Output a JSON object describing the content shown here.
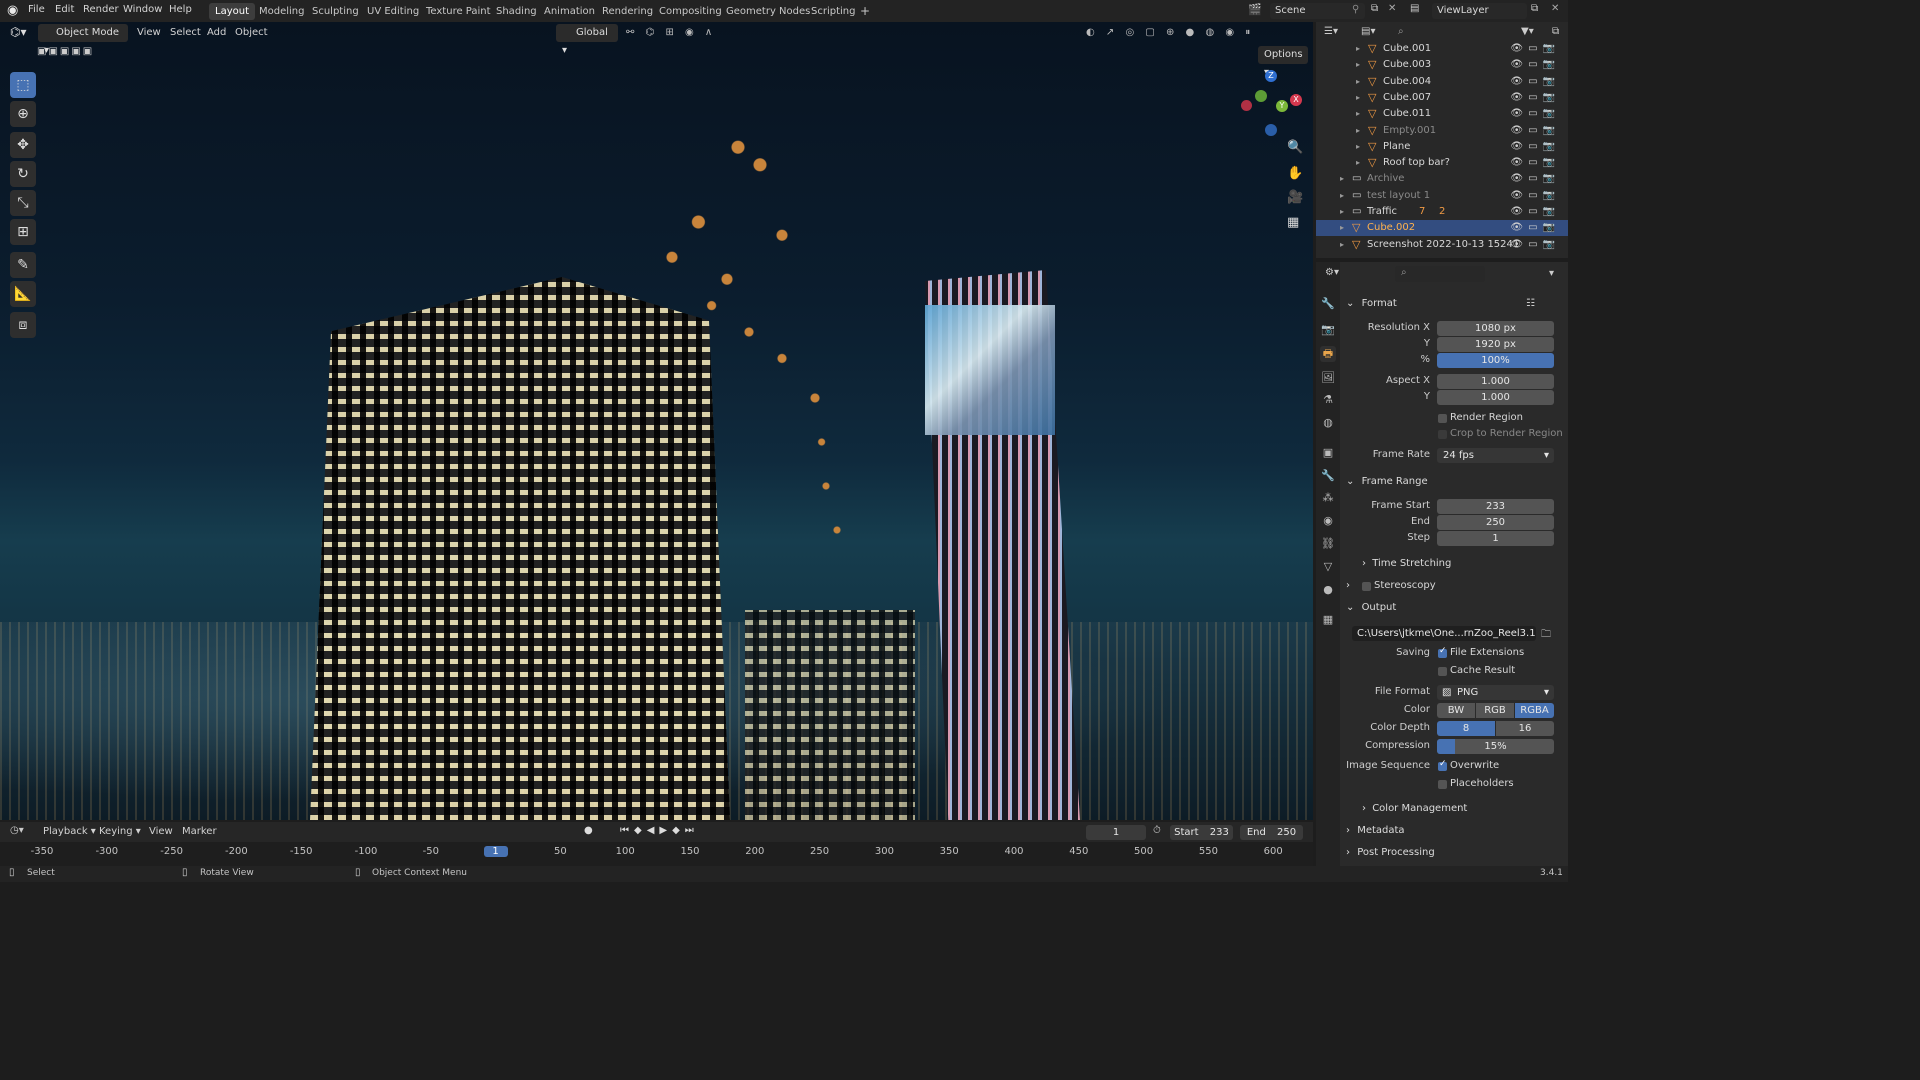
{
  "topbar": {
    "menus": [
      "File",
      "Edit",
      "Render",
      "Window",
      "Help"
    ],
    "workspaces": [
      "Layout",
      "Modeling",
      "Sculpting",
      "UV Editing",
      "Texture Paint",
      "Shading",
      "Animation",
      "Rendering",
      "Compositing",
      "Geometry Nodes",
      "Scripting"
    ],
    "add_tab": "+",
    "scene": "Scene",
    "view_layer": "ViewLayer"
  },
  "viewport_header": {
    "mode": "Object Mode",
    "menus": [
      "View",
      "Select",
      "Add",
      "Object"
    ],
    "transform_orientation": "Global",
    "options": "Options"
  },
  "outliner": {
    "rows": [
      {
        "label": "Cube.001",
        "kind": "object"
      },
      {
        "label": "Cube.003",
        "kind": "object"
      },
      {
        "label": "Cube.004",
        "kind": "object"
      },
      {
        "label": "Cube.007",
        "kind": "object"
      },
      {
        "label": "Cube.011",
        "kind": "object"
      },
      {
        "label": "Empty.001",
        "kind": "empty-dim"
      },
      {
        "label": "Plane",
        "kind": "object"
      },
      {
        "label": "Roof top bar?",
        "kind": "object"
      },
      {
        "label": "Archive",
        "kind": "collection-dim"
      },
      {
        "label": "test layout 1",
        "kind": "collection-dim"
      },
      {
        "label": "Traffic",
        "kind": "collection"
      },
      {
        "label": "Cube.002",
        "kind": "selected"
      },
      {
        "label": "Screenshot 2022-10-13 15241",
        "kind": "object"
      }
    ],
    "traffic_count_1": "7",
    "traffic_count_2": "2"
  },
  "properties": {
    "format": {
      "title": "Format",
      "resolution_x_label": "Resolution X",
      "resolution_x": "1080 px",
      "y_label": "Y",
      "resolution_y": "1920 px",
      "percent_label": "%",
      "percent": "100%",
      "aspect_x_label": "Aspect X",
      "aspect_x": "1.000",
      "aspect_y_label": "Y",
      "aspect_y": "1.000",
      "render_region": "Render Region",
      "crop": "Crop to Render Region",
      "frame_rate_label": "Frame Rate",
      "frame_rate": "24 fps"
    },
    "frame_range": {
      "title": "Frame Range",
      "start_label": "Frame Start",
      "start": "233",
      "end_label": "End",
      "end": "250",
      "step_label": "Step",
      "step": "1",
      "time_stretching": "Time Stretching"
    },
    "stereoscopy": "Stereoscopy",
    "output": {
      "title": "Output",
      "path": "C:\\Users\\jtkme\\One...rnZoo_Reel3.1.blend",
      "saving_label": "Saving",
      "file_extensions": "File Extensions",
      "cache_result": "Cache Result",
      "file_format_label": "File Format",
      "file_format": "PNG",
      "color_label": "Color",
      "color_options": [
        "BW",
        "RGB",
        "RGBA"
      ],
      "color_selected": "RGBA",
      "depth_label": "Color Depth",
      "depth_options": [
        "8",
        "16"
      ],
      "depth_selected": "8",
      "compression_label": "Compression",
      "compression": "15%",
      "compression_value": 0.15,
      "image_sequence_label": "Image Sequence",
      "overwrite": "Overwrite",
      "placeholders": "Placeholders",
      "color_management": "Color Management"
    },
    "metadata": "Metadata",
    "post_processing": "Post Processing"
  },
  "timeline": {
    "menus": [
      "Playback",
      "Keying",
      "View",
      "Marker"
    ],
    "current_frame": "1",
    "start_label": "Start",
    "start": "233",
    "end_label": "End",
    "end": "250",
    "ticks": [
      "-350",
      "-300",
      "-250",
      "-200",
      "-150",
      "-100",
      "-50",
      "1",
      "50",
      "100",
      "150",
      "200",
      "250",
      "300",
      "350",
      "400",
      "450",
      "500",
      "550",
      "600"
    ],
    "playhead": "1"
  },
  "statusbar": {
    "select": "Select",
    "rotate": "Rotate View",
    "context": "Object Context Menu",
    "version": "3.4.1"
  },
  "colors": {
    "accent": "#4772b3",
    "selected_text": "#ffb24d",
    "object_icon": "#f09a44"
  }
}
